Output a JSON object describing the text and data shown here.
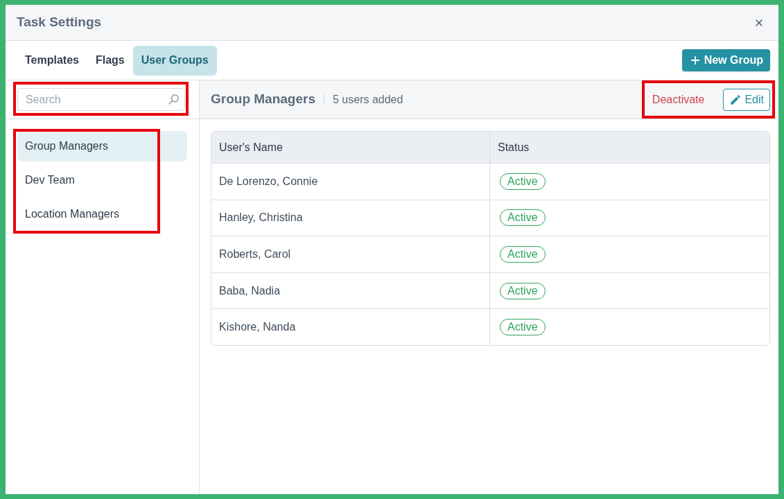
{
  "window": {
    "title": "Task Settings"
  },
  "tabs": [
    {
      "label": "Templates",
      "selected": false
    },
    {
      "label": "Flags",
      "selected": false
    },
    {
      "label": "User Groups",
      "selected": true
    }
  ],
  "new_group_button": {
    "label": "New Group"
  },
  "sidebar": {
    "search": {
      "placeholder": "Search",
      "highlighted": true
    },
    "groups_highlighted": true,
    "groups": [
      {
        "label": "Group Managers",
        "selected": true
      },
      {
        "label": "Dev Team",
        "selected": false
      },
      {
        "label": "Location Managers",
        "selected": false
      }
    ]
  },
  "group_header": {
    "title": "Group Managers",
    "count": "5 users added",
    "actions_highlighted": true,
    "deactivate": "Deactivate",
    "edit": "Edit"
  },
  "table": {
    "columns": [
      "User's Name",
      "Status"
    ],
    "rows": [
      {
        "name": "De Lorenzo, Connie",
        "status": "Active"
      },
      {
        "name": "Hanley, Christina",
        "status": "Active"
      },
      {
        "name": "Roberts, Carol",
        "status": "Active"
      },
      {
        "name": "Baba, Nadia",
        "status": "Active"
      },
      {
        "name": "Kishore, Nanda",
        "status": "Active"
      }
    ]
  }
}
